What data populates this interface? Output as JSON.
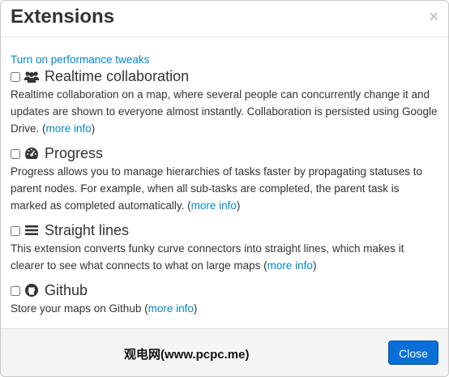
{
  "dialog": {
    "title": "Extensions",
    "close_glyph": "×",
    "tweaks_link": "Turn on performance tweaks",
    "watermark": "观电网(www.pcpc.me)",
    "close_button": "Close"
  },
  "extensions": [
    {
      "name": "Realtime collaboration",
      "icon": "users-icon",
      "desc_before": "Realtime collaboration on a map, where several people can concurrently change it and updates are shown to everyone almost instantly. Collaboration is persisted using Google Drive. (",
      "link": "more info",
      "desc_after": ")"
    },
    {
      "name": "Progress",
      "icon": "dashboard-icon",
      "desc_before": "Progress allows you to manage hierarchies of tasks faster by propagating statuses to parent nodes. For example, when all sub-tasks are completed, the parent task is marked as completed automatically. (",
      "link": "more info",
      "desc_after": ")"
    },
    {
      "name": "Straight lines",
      "icon": "lines-icon",
      "desc_before": "This extension converts funky curve connectors into straight lines, which makes it clearer to see what connects to what on large maps (",
      "link": "more info",
      "desc_after": ")"
    },
    {
      "name": "Github",
      "icon": "github-icon",
      "desc_before": "Store your maps on Github (",
      "link": "more info",
      "desc_after": ")"
    }
  ]
}
